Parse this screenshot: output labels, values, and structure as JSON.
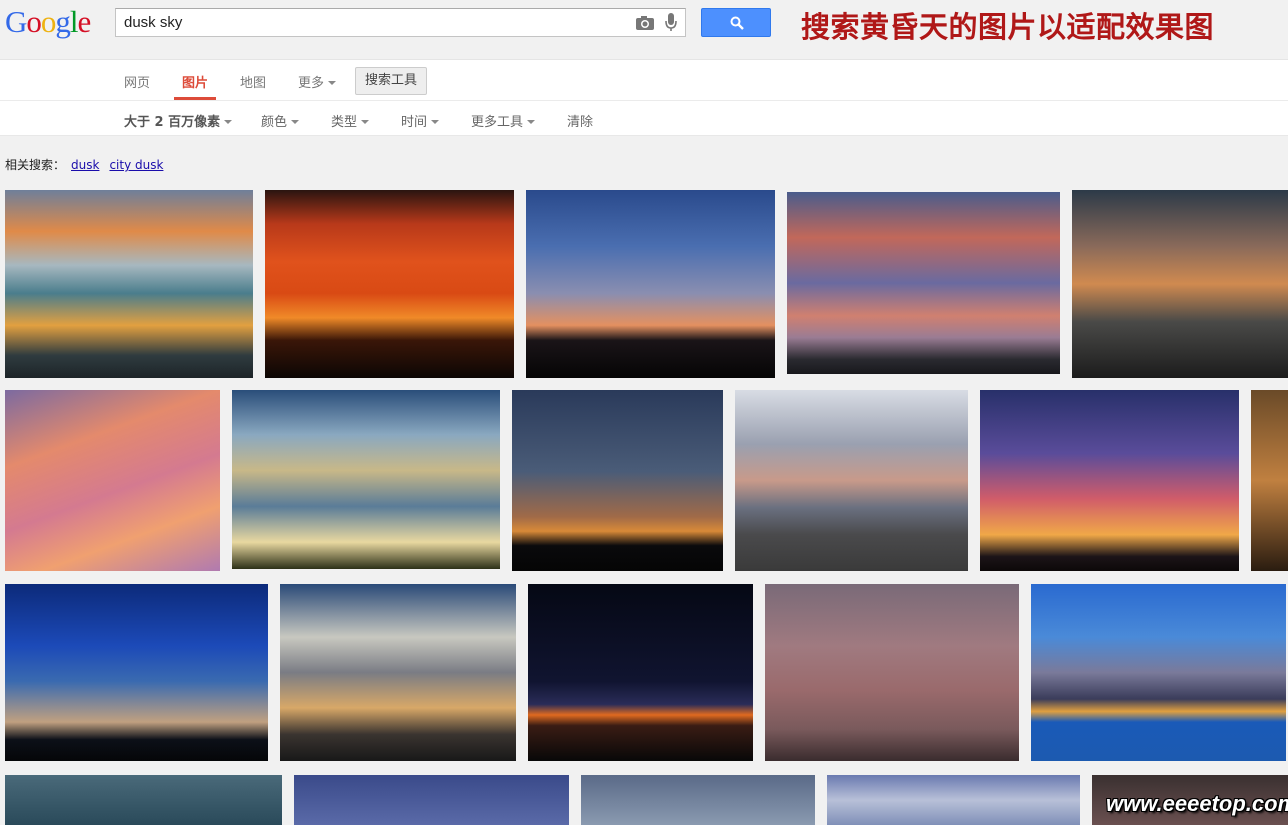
{
  "header": {
    "logo_letters": [
      {
        "ch": "G",
        "color": "#3369e8"
      },
      {
        "ch": "o",
        "color": "#d50f25"
      },
      {
        "ch": "o",
        "color": "#eeb211"
      },
      {
        "ch": "g",
        "color": "#3369e8"
      },
      {
        "ch": "l",
        "color": "#009925"
      },
      {
        "ch": "e",
        "color": "#d50f25"
      }
    ],
    "search_value": "dusk sky",
    "camera_icon": "camera-icon",
    "mic_icon": "microphone-icon",
    "search_button_icon": "magnifier-icon",
    "banner_text": "搜索黄昏天的图片以适配效果图",
    "banner_color": "#b01818"
  },
  "nav": {
    "tabs": [
      {
        "label": "网页",
        "active": false,
        "caret": false
      },
      {
        "label": "图片",
        "active": true,
        "caret": false
      },
      {
        "label": "地图",
        "active": false,
        "caret": false
      },
      {
        "label": "更多",
        "active": false,
        "caret": true
      }
    ],
    "tools_label": "搜索工具",
    "active_color": "#dd4b39"
  },
  "tools": {
    "items": [
      {
        "label": "大于 2 百万像素",
        "caret": true,
        "bold": true
      },
      {
        "label": "颜色",
        "caret": true,
        "bold": false
      },
      {
        "label": "类型",
        "caret": true,
        "bold": false
      },
      {
        "label": "时间",
        "caret": true,
        "bold": false
      },
      {
        "label": "更多工具",
        "caret": true,
        "bold": false
      },
      {
        "label": "清除",
        "caret": false,
        "bold": false
      }
    ]
  },
  "related": {
    "label": "相关搜索：",
    "links": [
      "dusk",
      "city dusk"
    ]
  },
  "watermark": "www.eeeetop.com",
  "images": [
    {
      "name": "image-dusk-sky-1"
    },
    {
      "name": "image-dusk-sky-2"
    },
    {
      "name": "image-dusk-sky-3"
    },
    {
      "name": "image-dusk-sky-4"
    },
    {
      "name": "image-dusk-sky-5"
    },
    {
      "name": "image-dusk-sky-6"
    },
    {
      "name": "image-dusk-sky-7"
    },
    {
      "name": "image-dusk-sky-8"
    },
    {
      "name": "image-dusk-sky-9"
    },
    {
      "name": "image-dusk-sky-10"
    },
    {
      "name": "image-dusk-sky-11"
    },
    {
      "name": "image-dusk-sky-12"
    },
    {
      "name": "image-dusk-sky-13"
    },
    {
      "name": "image-dusk-sky-14"
    },
    {
      "name": "image-dusk-sky-15"
    },
    {
      "name": "image-dusk-sky-16"
    },
    {
      "name": "image-dusk-sky-17"
    },
    {
      "name": "image-dusk-sky-18"
    },
    {
      "name": "image-dusk-sky-19"
    },
    {
      "name": "image-dusk-sky-20"
    },
    {
      "name": "image-dusk-sky-21"
    },
    {
      "name": "image-dusk-sky-22"
    }
  ]
}
